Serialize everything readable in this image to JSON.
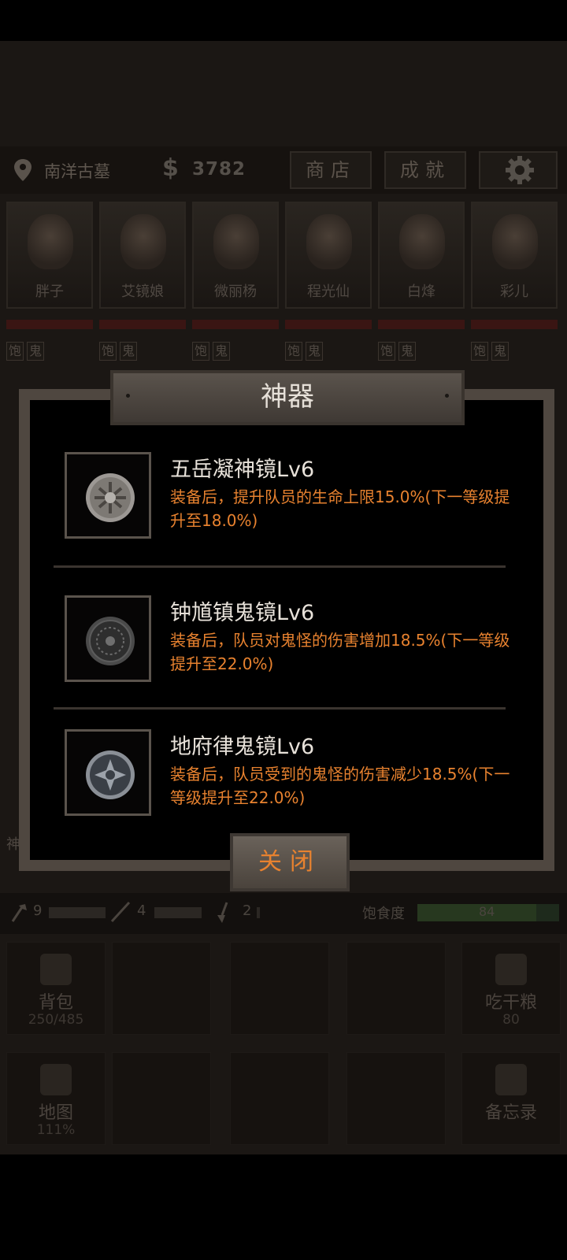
{
  "header": {
    "location": "南洋古墓",
    "money_symbol": "$",
    "money": "3782",
    "shop_label": "商店",
    "achievements_label": "成就"
  },
  "characters": [
    {
      "name": "胖子"
    },
    {
      "name": "艾镜娘"
    },
    {
      "name": "微丽杨"
    },
    {
      "name": "程光仙"
    },
    {
      "name": "白烽"
    },
    {
      "name": "彩儿"
    }
  ],
  "status_tags": [
    "饱",
    "鬼"
  ],
  "modal": {
    "title": "神器",
    "items": [
      {
        "name": "五岳凝神镜Lv6",
        "desc": "装备后，提升队员的生命上限15.0%(下一等级提升至18.0%)"
      },
      {
        "name": "钟馗镇鬼镜Lv6",
        "desc": "装备后，队员对鬼怪的伤害增加18.5%(下一等级提升至22.0%)"
      },
      {
        "name": "地府律鬼镜Lv6",
        "desc": "装备后，队员受到的鬼怪的伤害减少18.5%(下一等级提升至22.0%)"
      }
    ],
    "close_label": "关闭"
  },
  "side_char": "神",
  "stats": {
    "tool1": "9",
    "tool2": "4",
    "tool3": "2",
    "hunger_label": "饱食度",
    "hunger_value": "84",
    "hunger_fraction": 0.84
  },
  "tiles": {
    "backpack_label": "背包",
    "backpack_value": "250/485",
    "eat_label": "吃干粮",
    "eat_value": "80",
    "map_label": "地图",
    "map_value": "111%",
    "memo_label": "备忘录"
  },
  "colors": {
    "accent_orange": "#e8822f",
    "modal_frame": "#4f4740",
    "hp_bar": "#3a1513"
  }
}
